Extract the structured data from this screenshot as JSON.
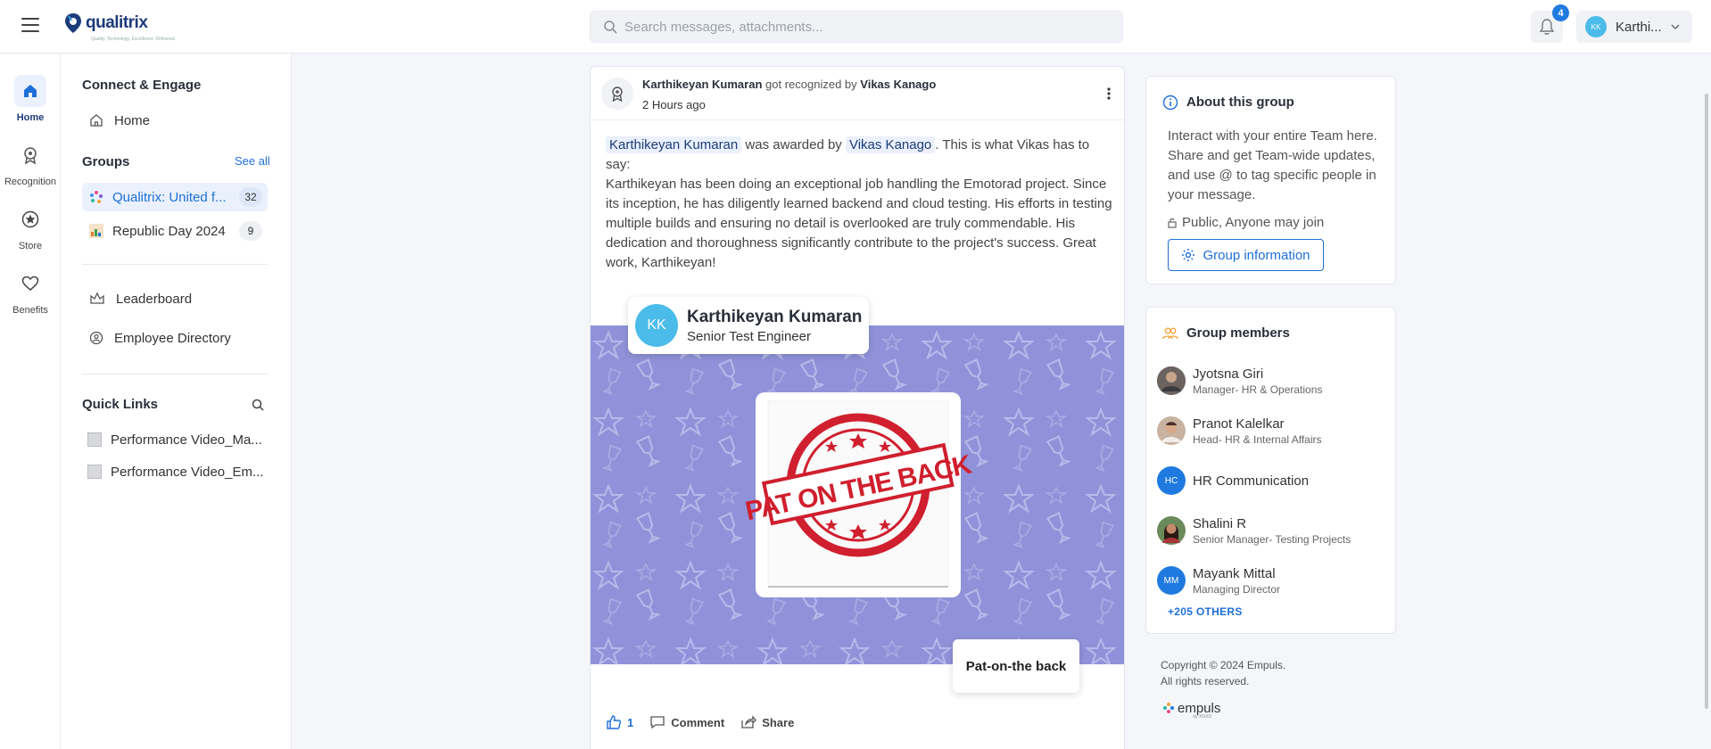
{
  "header": {
    "logo_text": "qualitrix",
    "logo_tagline": "Quality, Technology, Excellence. Delivered.",
    "search_placeholder": "Search messages, attachments...",
    "notification_count": "4",
    "user_initials": "KK",
    "user_name": "Karthi..."
  },
  "rail": {
    "items": [
      {
        "label": "Home",
        "icon": "home-icon"
      },
      {
        "label": "Recognition",
        "icon": "award-icon"
      },
      {
        "label": "Store",
        "icon": "star-icon"
      },
      {
        "label": "Benefits",
        "icon": "heart-icon"
      }
    ]
  },
  "sidebar": {
    "section_title": "Connect & Engage",
    "home_label": "Home",
    "groups_title": "Groups",
    "see_all": "See all",
    "groups": [
      {
        "name": "Qualitrix: United f...",
        "count": "32"
      },
      {
        "name": "Republic Day 2024",
        "count": "9"
      }
    ],
    "leaderboard": "Leaderboard",
    "employee_directory": "Employee Directory",
    "quick_links_title": "Quick Links",
    "quick_links": [
      "Performance Video_Ma...",
      "Performance Video_Em..."
    ]
  },
  "post": {
    "recipient": "Karthikeyan Kumaran",
    "action_text": "got recognized by",
    "giver": "Vikas Kanago",
    "time": "2 Hours ago",
    "body_mid": " was awarded by ",
    "body_after": ". This is what Vikas has to say:",
    "message": "Karthikeyan has been doing an exceptional job handling the Emotorad project. Since its inception, he has diligently learned backend and cloud testing. His efforts in testing multiple builds and ensuring no detail is overlooked are truly commendable. His dedication and thoroughness significantly contribute to the project's success. Great work, Karthikeyan!",
    "card_initials": "KK",
    "card_name": "Karthikeyan Kumaran",
    "card_role": "Senior Test Engineer",
    "badge_stamp_text": "PAT ON THE BACK",
    "badge_name": "Pat-on-the back",
    "like_count": "1",
    "comment_label": "Comment",
    "share_label": "Share",
    "banner_color": "#8f92d8"
  },
  "about": {
    "title": "About this group",
    "description": "Interact with your entire Team here. Share and get Team-wide updates, and use @ to tag specific people in your message.",
    "privacy": "Public, Anyone may join",
    "button_label": "Group information"
  },
  "members": {
    "title": "Group members",
    "list": [
      {
        "name": "Jyotsna Giri",
        "role": "Manager- HR & Operations",
        "initials": "",
        "color": "#7a6f6a"
      },
      {
        "name": "Pranot Kalelkar",
        "role": "Head- HR & Internal Affairs",
        "initials": "",
        "color": "#b8907a"
      },
      {
        "name": "HR Communication",
        "role": "",
        "initials": "HC",
        "color": "#1f7ae0"
      },
      {
        "name": "Shalini R",
        "role": "Senior Manager- Testing Projects",
        "initials": "",
        "color": "#5a7a4a"
      },
      {
        "name": "Mayank Mittal",
        "role": "Managing Director",
        "initials": "MM",
        "color": "#1f7ae0"
      }
    ],
    "more": "+205 OTHERS"
  },
  "footer": {
    "copyright_line1": "Copyright © 2024 Empuls.",
    "copyright_line2": "All rights reserved.",
    "brand": "empuls",
    "brand_sub": "by XOXO"
  }
}
